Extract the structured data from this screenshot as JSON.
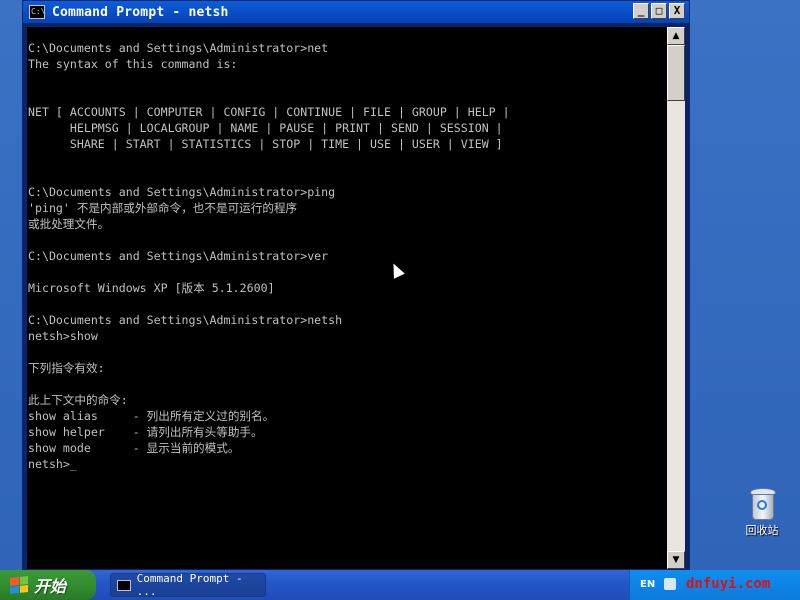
{
  "window": {
    "title": "Command Prompt - netsh",
    "icon_text": "C:\\",
    "minimize": "_",
    "maximize": "□",
    "close": "X"
  },
  "console": {
    "lines": [
      "C:\\Documents and Settings\\Administrator>net",
      "The syntax of this command is:",
      "",
      "",
      "NET [ ACCOUNTS | COMPUTER | CONFIG | CONTINUE | FILE | GROUP | HELP |",
      "      HELPMSG | LOCALGROUP | NAME | PAUSE | PRINT | SEND | SESSION |",
      "      SHARE | START | STATISTICS | STOP | TIME | USE | USER | VIEW ]",
      "",
      "",
      "C:\\Documents and Settings\\Administrator>ping",
      "'ping' 不是内部或外部命令，也不是可运行的程序",
      "或批处理文件。",
      "",
      "C:\\Documents and Settings\\Administrator>ver",
      "",
      "Microsoft Windows XP [版本 5.1.2600]",
      "",
      "C:\\Documents and Settings\\Administrator>netsh",
      "netsh>show",
      "",
      "下列指令有效:",
      "",
      "此上下文中的命令:",
      "show alias     - 列出所有定义过的别名。",
      "show helper    - 请列出所有头等助手。",
      "show mode      - 显示当前的模式。",
      "netsh>_"
    ]
  },
  "desktop": {
    "recycle_bin_label": "回收站"
  },
  "taskbar": {
    "start_label": "开始",
    "task_label": "Command Prompt - ...",
    "language": "EN",
    "watermark": "dnfuyi.com"
  },
  "colors": {
    "console_bg": "#000000",
    "console_fg": "#c0c0c0",
    "titlebar": "#0542b8",
    "taskbar": "#2456c7",
    "start": "#2f8a2d"
  }
}
